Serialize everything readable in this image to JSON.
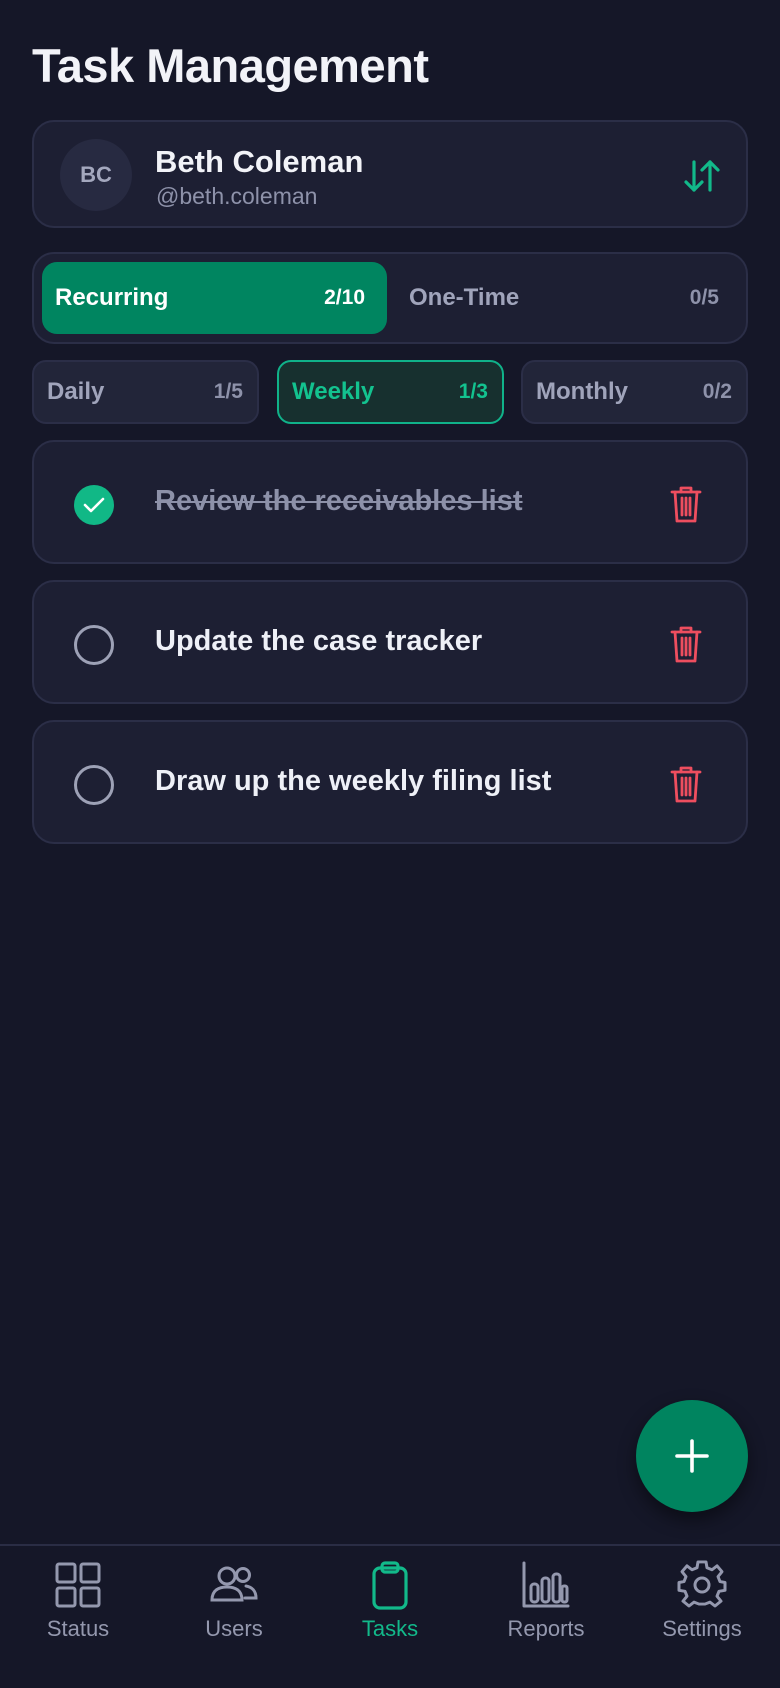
{
  "header": {
    "title": "Task Management"
  },
  "user": {
    "initials": "BC",
    "name": "Beth Coleman",
    "handle": "@beth.coleman",
    "sort_icon": "sort-arrows-icon"
  },
  "type_tabs": [
    {
      "label": "Recurring",
      "count": "2/10",
      "active": true
    },
    {
      "label": "One-Time",
      "count": "0/5",
      "active": false
    }
  ],
  "frequency_tabs": [
    {
      "label": "Daily",
      "count": "1/5",
      "active": false
    },
    {
      "label": "Weekly",
      "count": "1/3",
      "active": true
    },
    {
      "label": "Monthly",
      "count": "0/2",
      "active": false
    }
  ],
  "tasks": [
    {
      "text": "Review the receivables list",
      "done": true
    },
    {
      "text": "Update the case tracker",
      "done": false
    },
    {
      "text": "Draw up the weekly filing list",
      "done": false
    }
  ],
  "fab": {
    "icon": "plus-icon"
  },
  "nav": [
    {
      "label": "Status",
      "icon": "grid-icon",
      "active": false
    },
    {
      "label": "Users",
      "icon": "users-icon",
      "active": false
    },
    {
      "label": "Tasks",
      "icon": "clipboard-icon",
      "active": true
    },
    {
      "label": "Reports",
      "icon": "bar-chart-icon",
      "active": false
    },
    {
      "label": "Settings",
      "icon": "gear-icon",
      "active": false
    }
  ],
  "colors": {
    "background": "#151728",
    "card": "#1d1f33",
    "accent": "#008560",
    "accent_text": "#13c28f",
    "danger": "#ee4e5f"
  }
}
